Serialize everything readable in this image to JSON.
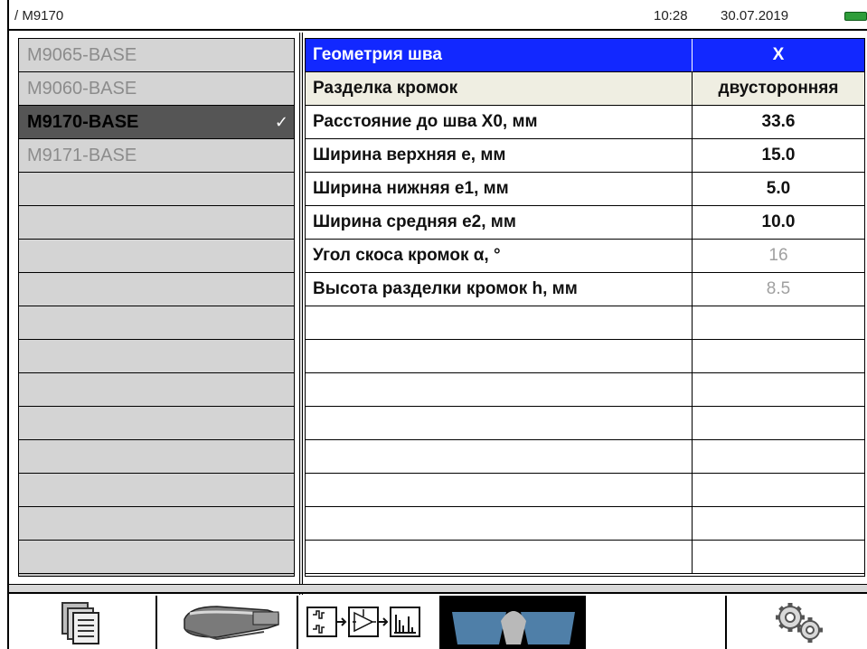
{
  "status": {
    "path": "/ M9170",
    "time": "10:28",
    "date": "30.07.2019",
    "battery_color": "#2e9d3a"
  },
  "probes": [
    {
      "name": "M9065-BASE",
      "selected": false
    },
    {
      "name": "M9060-BASE",
      "selected": false
    },
    {
      "name": "M9170-BASE",
      "selected": true,
      "check": "✓"
    },
    {
      "name": "M9171-BASE",
      "selected": false
    }
  ],
  "params": {
    "header": {
      "name": "Геометрия шва",
      "value": "X"
    },
    "rows": [
      {
        "name": "Разделка кромок",
        "value": "двусторонняя"
      },
      {
        "name": "Расстояние до шва X0, мм",
        "value": "33.6"
      },
      {
        "name": "Ширина верхняя e, мм",
        "value": "15.0"
      },
      {
        "name": "Ширина нижняя e1, мм",
        "value": "5.0"
      },
      {
        "name": "Ширина средняя e2, мм",
        "value": "10.0"
      },
      {
        "name": "Угол скоса кромок α, °",
        "value": "16"
      },
      {
        "name": "Высота разделки кромок h, мм",
        "value": "8.5"
      }
    ]
  },
  "toolbar": {
    "buttons": [
      "documents-icon",
      "probe-icon",
      "signal-chain-icon",
      "weld-geometry-icon",
      "settings-gears-icon"
    ],
    "active": "weld-geometry-icon"
  },
  "colors": {
    "header_blue": "#1228ff",
    "selected_row": "#555555",
    "active_tab": "#000000"
  }
}
